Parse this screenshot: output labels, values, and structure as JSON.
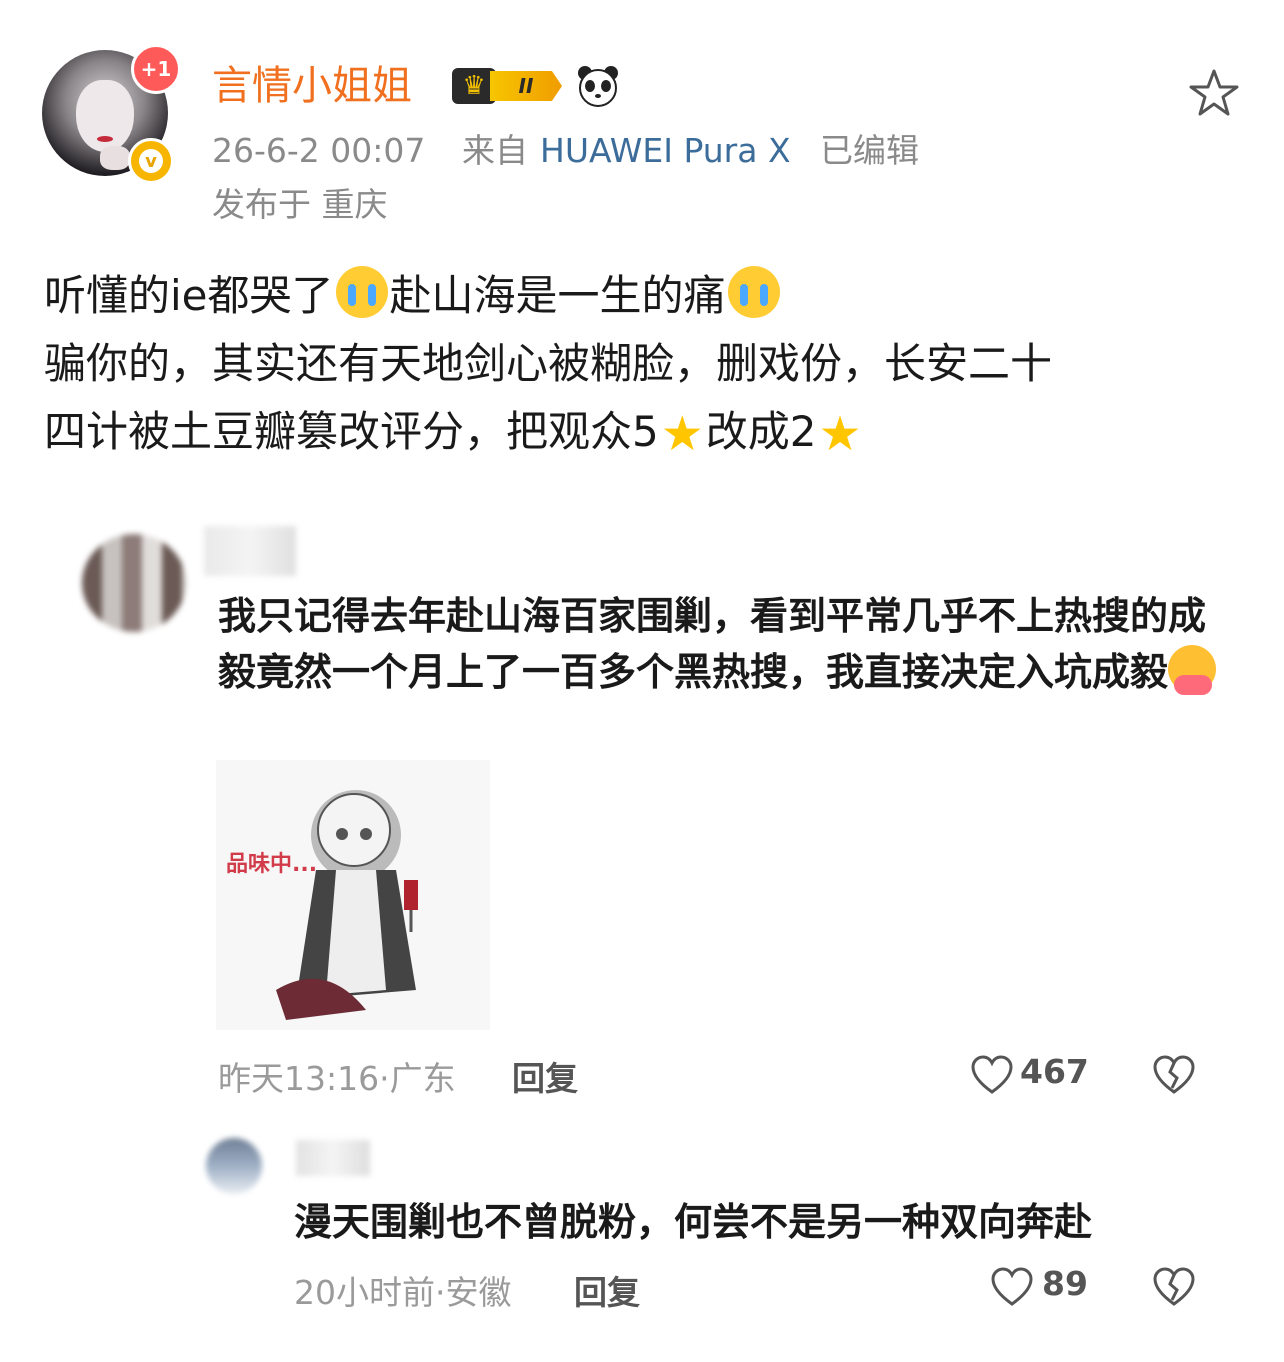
{
  "post": {
    "author": {
      "name": "言情小姐姐",
      "notification_badge": "+1",
      "level_badge": "II",
      "icons": [
        "crown-icon",
        "panda-icon",
        "verified-icon"
      ]
    },
    "time": "26-6-2 00:07",
    "from_label": "来自",
    "device": "HUAWEI Pura X",
    "edited": "已编辑",
    "location": "发布于 重庆",
    "body": {
      "line1_a": "听懂的ie都哭了",
      "line1_b": "赴山海是一生的痛",
      "line2": "骗你的，其实还有天地剑心被糊脸，删戏份，长安二十",
      "line3_a": "四计被土豆瓣篡改评分，把观众5",
      "line3_b": "改成2"
    }
  },
  "comments": [
    {
      "text_a": "我只记得去年赴山海百家围剿，看到平常几乎不上热搜的成毅竟然一个月上了一百多个黑热搜，我直接决定入坑成毅",
      "image_caption": "品味中...",
      "time_location": "昨天13:16·广东",
      "reply_label": "回复",
      "likes": "467"
    },
    {
      "text_a": "漫天围剿也不曾脱粉，何尝不是另一种双向奔赴",
      "time_location": "20小时前·安徽",
      "reply_label": "回复",
      "likes": "89"
    }
  ],
  "colors": {
    "username": "#f0701f",
    "device_link": "#3c6d9a",
    "meta_gray": "#8a8a8a",
    "badge_red": "#ff5a5a",
    "verified_gold": "#f7b500"
  }
}
